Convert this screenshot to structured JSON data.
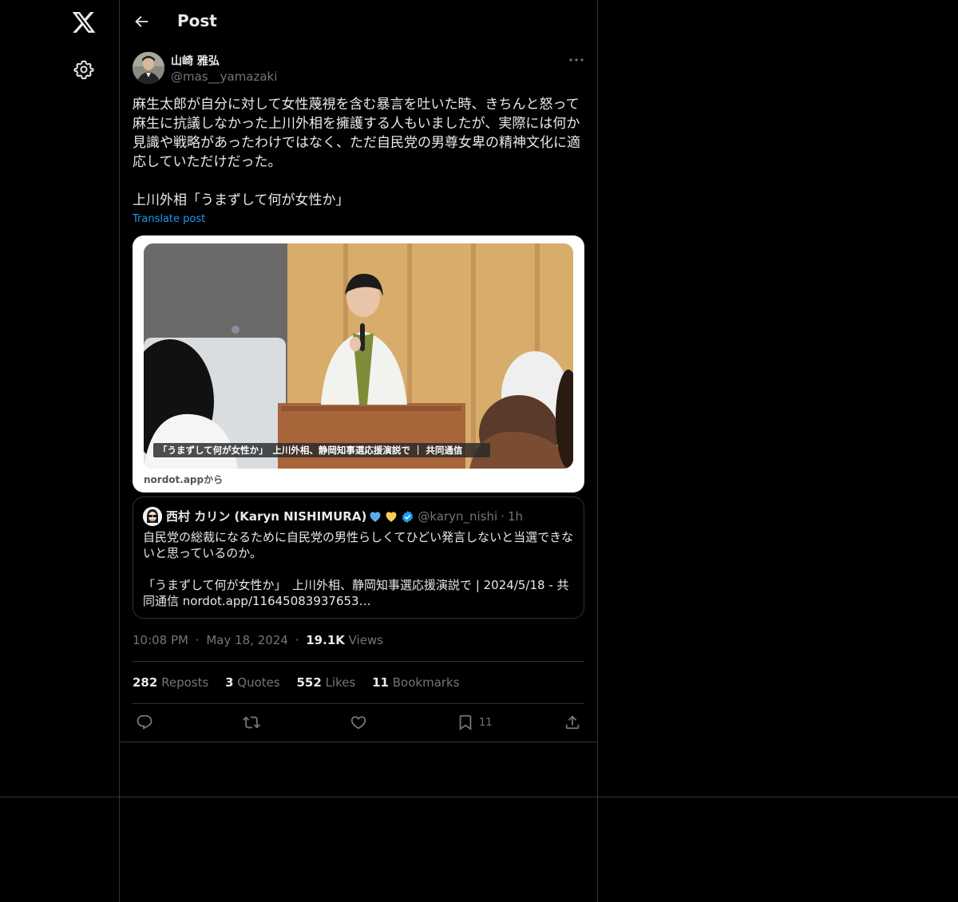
{
  "header": {
    "title": "Post"
  },
  "author": {
    "name": "山崎 雅弘",
    "handle": "@mas__yamazaki"
  },
  "post": {
    "text": "麻生太郎が自分に対して女性蔑視を含む暴言を吐いた時、きちんと怒って\n麻生に抗議しなかった上川外相を擁護する人もいましたが、実際には何か\n見識や戦略があったわけではなく、ただ自民党の男尊女卑の精神文化に適\n応していただけだった。\n\n上川外相「うまずして何が女性か」",
    "translate_label": "Translate post"
  },
  "link_card": {
    "caption": "「うまずして何が女性か」　上川外相、静岡知事選応援演説で ｜ 共同通信",
    "domain": "nordot.appから"
  },
  "quote": {
    "name": "西村 カリン (Karyn NISHIMURA)",
    "handle": "@karyn_nishi",
    "separator": "·",
    "time": "1h",
    "text": "自民党の総裁になるために自民党の男性らしくてひどい発言しないと当選できな\nいと思っているのか。\n\n「うまずして何が女性か」　上川外相、静岡知事選応援演説で | 2024/5/18 - 共\n同通信 nordot.app/11645083937653…"
  },
  "meta": {
    "time": "10:08 PM",
    "dot": "·",
    "date": "May 18, 2024",
    "views_count": "19.1K",
    "views_label": "Views"
  },
  "stats": {
    "reposts_count": "282",
    "reposts_label": "Reposts",
    "quotes_count": "3",
    "quotes_label": "Quotes",
    "likes_count": "552",
    "likes_label": "Likes",
    "bookmarks_count": "11",
    "bookmarks_label": "Bookmarks"
  },
  "actions": {
    "bookmark_count": "11"
  },
  "icons": [
    "x-logo-icon",
    "gear-icon",
    "back-arrow-icon",
    "more-icon",
    "heart-blue-icon",
    "heart-yellow-icon",
    "verified-badge-icon",
    "reply-icon",
    "repost-icon",
    "like-icon",
    "bookmark-icon",
    "share-icon"
  ],
  "colors": {
    "background": "#000000",
    "text": "#e7e9ea",
    "secondary": "#71767b",
    "link": "#1d9bf0",
    "border": "#2f3336"
  }
}
